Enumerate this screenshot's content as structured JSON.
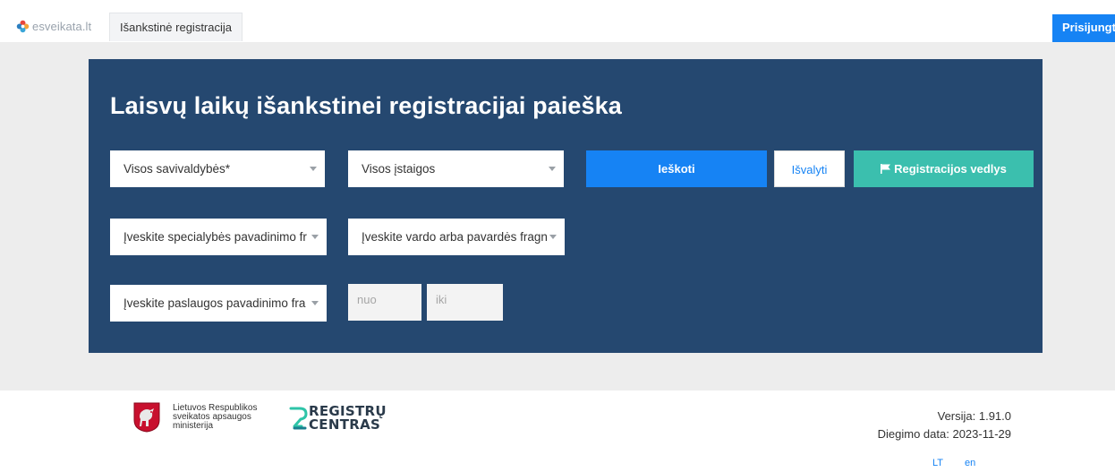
{
  "nav": {
    "brand": "esveikata.lt",
    "tab": "Išankstinė registracija",
    "login": "Prisijungti"
  },
  "search": {
    "title": "Laisvų laikų išankstinei registracijai paieška",
    "municipality": "Visos savivaldybės*",
    "institution": "Visos įstaigos",
    "specialty": "Įveskite specialybės pavadinimo fr",
    "name": "Įveskite vardo arba pavardės fragn",
    "service": "Įveskite paslaugos pavadinimo fra",
    "from_placeholder": "nuo",
    "to_placeholder": "iki",
    "search_button": "Ieškoti",
    "clear_button": "Išvalyti",
    "wizard_button": "Registracijos vedlys"
  },
  "footer": {
    "ministry_line1": "Lietuvos Respublikos",
    "ministry_line2": "sveikatos apsaugos",
    "ministry_line3": "ministerija",
    "rc_line1": "REGISTRŲ",
    "rc_line2": "CENTRAS",
    "version": "Versija: 1.91.0",
    "deploy_date": "Diegimo data: 2023-11-29",
    "lang_lt": "LT",
    "lang_en": "en"
  },
  "colors": {
    "panel": "#254870",
    "primary": "#1683f4",
    "teal": "#3bbfae",
    "login_underline": "#dd2833"
  }
}
